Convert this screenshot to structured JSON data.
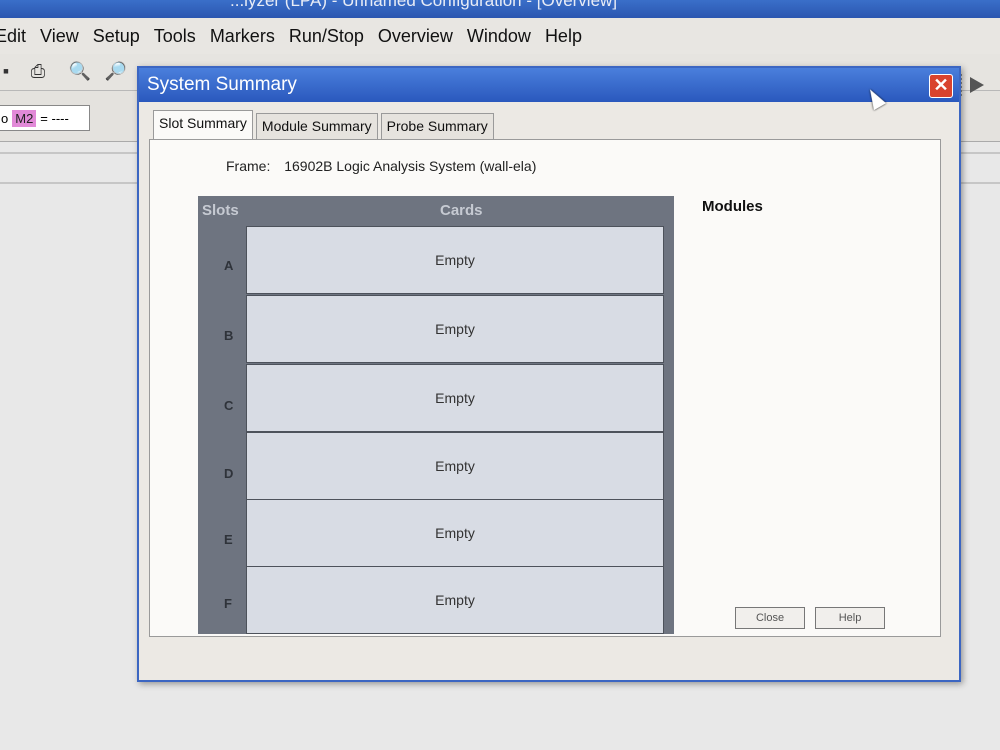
{
  "app": {
    "title": "...lyzer (LPA) - Unnamed Configuration - [Overview]"
  },
  "menubar": {
    "items": [
      "Edit",
      "View",
      "Setup",
      "Tools",
      "Markers",
      "Run/Stop",
      "Overview",
      "Window",
      "Help"
    ]
  },
  "toolbar": {
    "marker_name": "M2",
    "marker_value": "= ----"
  },
  "dialog": {
    "title": "System Summary",
    "close_glyph": "✕",
    "tabs": [
      "Slot Summary",
      "Module Summary",
      "Probe Summary"
    ],
    "active_tab": "Slot Summary",
    "frame_label": "Frame:",
    "frame_value": "16902B Logic Analysis System (wall-ela)",
    "slots_header": "Slots",
    "cards_header": "Cards",
    "modules_header": "Modules",
    "slots": [
      {
        "letter": "A",
        "card": "Empty"
      },
      {
        "letter": "B",
        "card": "Empty"
      },
      {
        "letter": "C",
        "card": "Empty"
      },
      {
        "letter": "D",
        "card": "Empty"
      },
      {
        "letter": "E",
        "card": "Empty"
      },
      {
        "letter": "F",
        "card": "Empty"
      }
    ],
    "buttons": {
      "close": "Close",
      "help": "Help"
    }
  },
  "colors": {
    "title_blue": "#2a58bd",
    "close_red": "#d9432e",
    "slots_grid": "#6e7480",
    "marker_pink": "#e28ad8"
  }
}
